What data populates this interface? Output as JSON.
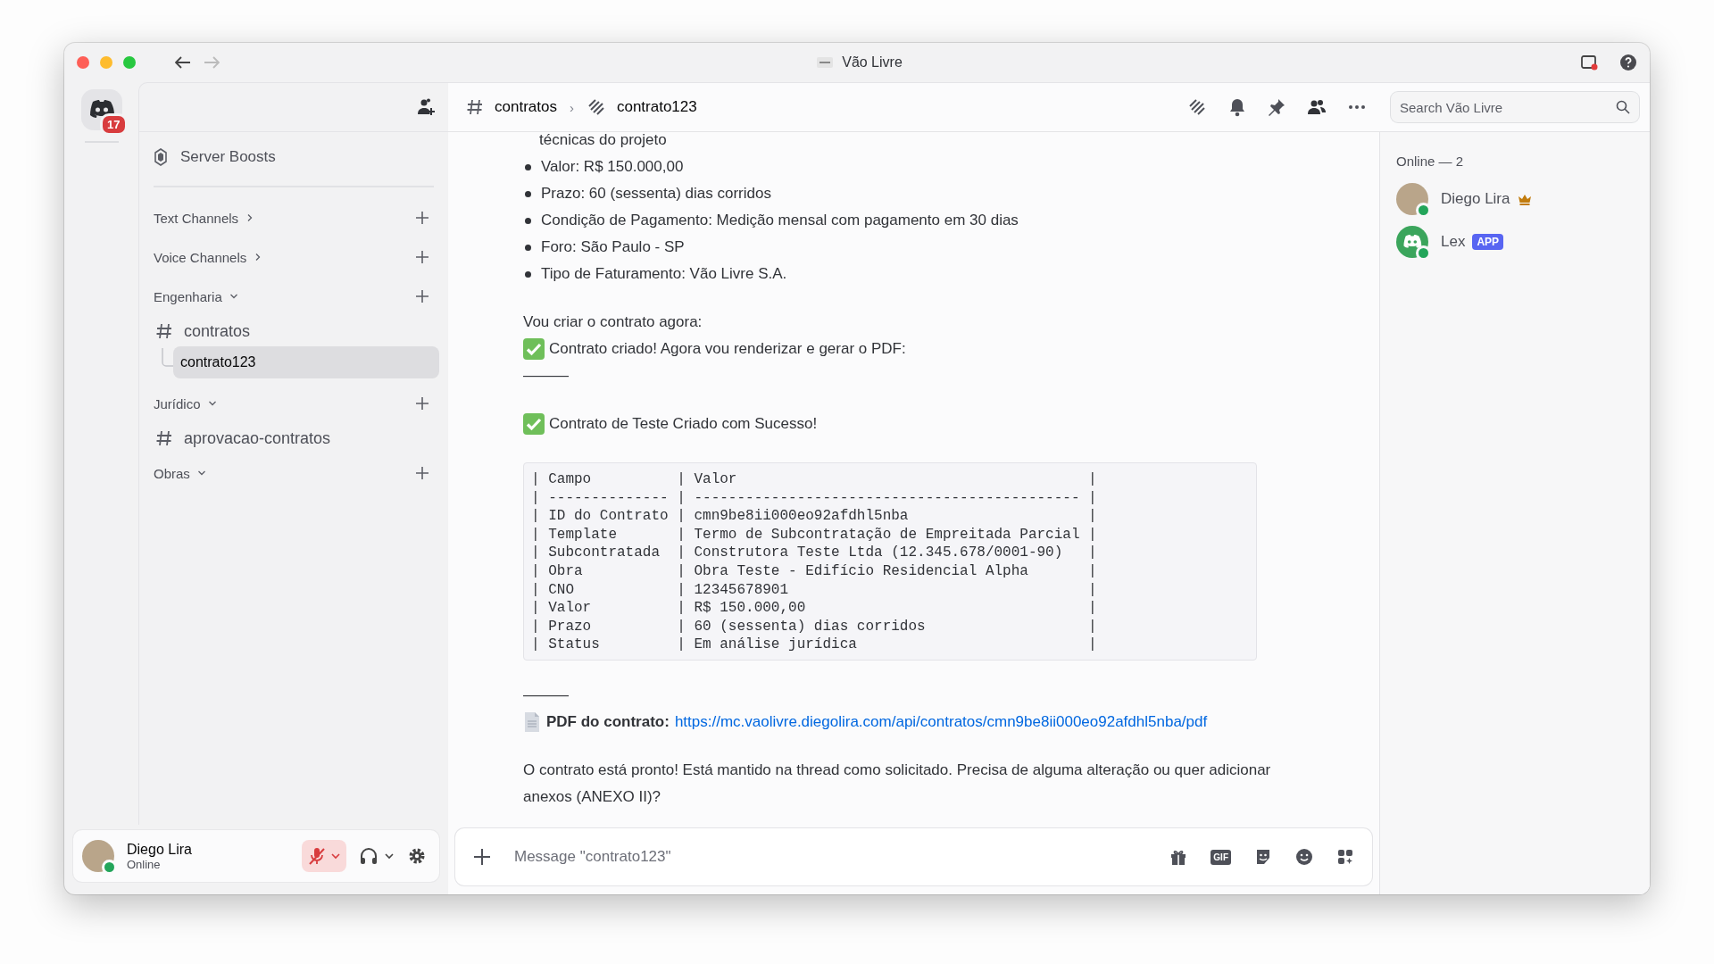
{
  "window": {
    "title": "Vão Livre"
  },
  "server_rail": {
    "badge": "17"
  },
  "sidebar": {
    "boosts": "Server Boosts",
    "categories": [
      {
        "name": "Text Channels",
        "expanded": false
      },
      {
        "name": "Voice Channels",
        "expanded": false
      },
      {
        "name": "Engenharia",
        "expanded": true,
        "channels": [
          {
            "name": "contratos",
            "selected": false,
            "threads": [
              {
                "name": "contrato123",
                "selected": true
              }
            ]
          }
        ]
      },
      {
        "name": "Jurídico",
        "expanded": true,
        "channels": [
          {
            "name": "aprovacao-contratos",
            "selected": false
          }
        ]
      },
      {
        "name": "Obras",
        "expanded": true
      }
    ]
  },
  "header": {
    "channel": "contratos",
    "separator": "›",
    "thread": "contrato123",
    "search_placeholder": "Search Vão Livre"
  },
  "messages": [
    {
      "kind": "continuation",
      "text": "técnicas do projeto"
    },
    {
      "kind": "bullet",
      "text": "Valor: R$ 150.000,00"
    },
    {
      "kind": "bullet",
      "text": "Prazo: 60 (sessenta) dias corridos"
    },
    {
      "kind": "bullet",
      "text": "Condição de Pagamento: Medição mensal com pagamento em 30 dias"
    },
    {
      "kind": "bullet",
      "text": "Foro: São Paulo - SP"
    },
    {
      "kind": "bullet",
      "text": "Tipo de Faturamento: Vão Livre S.A."
    },
    {
      "kind": "paragraph",
      "text": "Vou criar o contrato agora:"
    },
    {
      "kind": "check",
      "text": "Contrato criado! Agora vou renderizar e gerar o PDF:"
    },
    {
      "kind": "rule",
      "text": "———"
    },
    {
      "kind": "check",
      "text": "Contrato de Teste Criado com Sucesso!"
    },
    {
      "kind": "code",
      "lines": [
        "| Campo          | Valor                                         |",
        "| -------------- | --------------------------------------------- |",
        "| ID do Contrato | cmn9be8ii000eo92afdhl5nba                     |",
        "| Template       | Termo de Subcontratação de Empreitada Parcial |",
        "| Subcontratada  | Construtora Teste Ltda (12.345.678/0001-90)   |",
        "| Obra           | Obra Teste - Edifício Residencial Alpha       |",
        "| CNO            | 12345678901                                   |",
        "| Valor          | R$ 150.000,00                                 |",
        "| Prazo          | 60 (sessenta) dias corridos                   |",
        "| Status         | Em análise jurídica                           |"
      ]
    },
    {
      "kind": "rule",
      "text": "———"
    },
    {
      "kind": "link",
      "label": "PDF do contrato:",
      "url": "https://mc.vaolivre.diegolira.com/api/contratos/cmn9be8ii000eo92afdhl5nba/pdf"
    },
    {
      "kind": "paragraph",
      "text": "O contrato está pronto! Está mantido na thread como solicitado. Precisa de alguma alteração ou quer adicionar anexos (ANEXO II)?"
    }
  ],
  "composer": {
    "placeholder": "Message \"contrato123\"",
    "gif": "GIF"
  },
  "members": {
    "heading": "Online — 2",
    "list": [
      {
        "name": "Diego Lira",
        "bot": false,
        "owner": true,
        "online": true
      },
      {
        "name": "Lex",
        "bot": true,
        "owner": false,
        "online": true,
        "badge": "APP"
      }
    ]
  },
  "user_panel": {
    "name": "Diego Lira",
    "status": "Online",
    "online": true,
    "muted": true
  }
}
